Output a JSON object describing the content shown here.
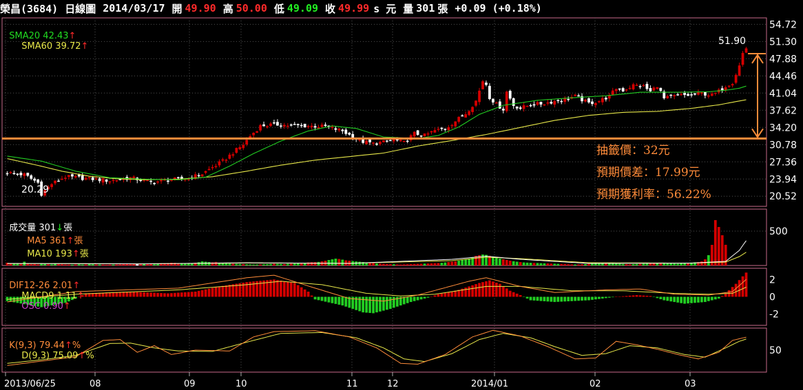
{
  "header": {
    "name": "榮昌(3684)",
    "period": "日線圖",
    "date": "2014/03/17",
    "open_label": "開",
    "open": "49.90",
    "high_label": "高",
    "high": "50.00",
    "low_label": "低",
    "low": "49.09",
    "close_label": "收",
    "close": "49.99",
    "unit": "s 元",
    "vol_label": "量",
    "volume": "301",
    "vol_unit": "張",
    "change": "+0.09 (+0.18%)"
  },
  "colors": {
    "up": "#d40000",
    "down": "#ffffff",
    "sma20": "#22cc22",
    "sma60": "#e8e84a",
    "frame": "#c86a8a",
    "grid": "#505050",
    "accent": "#ff8c3a",
    "osc": "#cc44cc"
  },
  "legends": {
    "price": {
      "sma20": "SMA20 42.43",
      "sma60": "SMA60 39.72",
      "arrow": "↑"
    },
    "volume": {
      "label": "成交量 301",
      "down_arrow": "↓",
      "unit": "張",
      "ma5": "MA5 361",
      "ma10": "MA10 193",
      "arrow": "↑"
    },
    "macd": {
      "dif": "DIF12-26 2.01",
      "macd": "MACD9 1.11",
      "osc": "OSC 0.90",
      "arrow": "↑"
    },
    "kd": {
      "k": "K(9,3) 79.44",
      "d": "D(9,3) 75.09",
      "arrow": "↑",
      "pct": "%"
    }
  },
  "annotations": {
    "lottery_price": "抽籤價：32元",
    "expected_spread": "預期價差：17.99元",
    "expected_return": "預期獲利率：56.22%",
    "high_label": "51.90",
    "low_label": "20.29"
  },
  "chart_data": [
    {
      "type": "candlestick",
      "title": "榮昌(3684) 日線圖",
      "ylim": [
        18.5,
        56
      ],
      "y_ticks": [
        "54.72",
        "51.30",
        "47.88",
        "44.46",
        "41.04",
        "37.62",
        "34.20",
        "30.78",
        "27.36",
        "23.94",
        "20.52"
      ],
      "x_ticks": [
        "2013/06/25",
        "08",
        "09",
        "10",
        "11",
        "12",
        "2014/01",
        "02",
        "03"
      ],
      "reference_line": 32,
      "recent_high": 51.9,
      "period_low": 20.29,
      "close_path": [
        [
          0,
          25.2
        ],
        [
          5,
          24.8
        ],
        [
          9,
          23.2
        ],
        [
          10,
          21.0
        ],
        [
          13,
          23.0
        ],
        [
          17,
          24.4
        ],
        [
          24,
          24.0
        ],
        [
          30,
          23.6
        ],
        [
          36,
          24.2
        ],
        [
          42,
          23.3
        ],
        [
          48,
          23.8
        ],
        [
          53,
          24.1
        ],
        [
          57,
          25.0
        ],
        [
          60,
          26.3
        ],
        [
          63,
          27.5
        ],
        [
          66,
          29.2
        ],
        [
          69,
          30.8
        ],
        [
          71,
          32.5
        ],
        [
          74,
          34.5
        ],
        [
          78,
          34.8
        ],
        [
          83,
          34.6
        ],
        [
          88,
          34.5
        ],
        [
          93,
          34.4
        ],
        [
          98,
          33.5
        ],
        [
          103,
          31.5
        ],
        [
          107,
          31.0
        ],
        [
          110,
          31.3
        ],
        [
          113,
          31.7
        ],
        [
          116,
          31.2
        ],
        [
          119,
          33.0
        ],
        [
          122,
          32.6
        ],
        [
          125,
          33.6
        ],
        [
          128,
          34.0
        ],
        [
          131,
          35.5
        ],
        [
          134,
          37.0
        ],
        [
          137,
          39.5
        ],
        [
          139,
          43.5
        ],
        [
          140,
          42.8
        ],
        [
          141,
          40.2
        ],
        [
          143,
          38.8
        ],
        [
          145,
          37.8
        ],
        [
          146,
          41.3
        ],
        [
          148,
          38.6
        ],
        [
          150,
          38.0
        ],
        [
          153,
          38.8
        ],
        [
          156,
          38.9
        ],
        [
          159,
          39.3
        ],
        [
          162,
          39.7
        ],
        [
          166,
          40.4
        ],
        [
          170,
          39.0
        ],
        [
          173,
          39.5
        ],
        [
          176,
          40.4
        ],
        [
          178,
          42.0
        ],
        [
          180,
          41.6
        ],
        [
          183,
          42.6
        ],
        [
          186,
          42.4
        ],
        [
          188,
          41.3
        ],
        [
          190,
          42.6
        ],
        [
          192,
          39.9
        ],
        [
          194,
          40.3
        ],
        [
          197,
          40.6
        ],
        [
          200,
          40.6
        ],
        [
          203,
          41.0
        ],
        [
          206,
          40.6
        ],
        [
          208,
          41.4
        ],
        [
          210,
          42.5
        ],
        [
          212,
          43.2
        ],
        [
          214,
          46.5
        ],
        [
          215,
          49.0
        ],
        [
          216,
          50.0
        ]
      ],
      "sma20_path": [
        [
          0,
          28.5
        ],
        [
          10,
          27.5
        ],
        [
          20,
          25.5
        ],
        [
          30,
          24.2
        ],
        [
          40,
          23.9
        ],
        [
          50,
          23.8
        ],
        [
          58,
          24.3
        ],
        [
          65,
          26.5
        ],
        [
          72,
          29.0
        ],
        [
          80,
          31.5
        ],
        [
          88,
          33.5
        ],
        [
          95,
          34.5
        ],
        [
          102,
          34.0
        ],
        [
          110,
          32.3
        ],
        [
          120,
          32.0
        ],
        [
          126,
          32.6
        ],
        [
          132,
          34.3
        ],
        [
          138,
          36.8
        ],
        [
          145,
          38.6
        ],
        [
          155,
          39.6
        ],
        [
          165,
          40.1
        ],
        [
          175,
          40.5
        ],
        [
          185,
          41.2
        ],
        [
          195,
          41.2
        ],
        [
          205,
          41.3
        ],
        [
          210,
          41.6
        ],
        [
          214,
          42.0
        ],
        [
          216,
          42.43
        ]
      ],
      "sma60_path": [
        [
          0,
          28.0
        ],
        [
          8,
          26.8
        ],
        [
          16,
          25.5
        ],
        [
          24,
          24.5
        ],
        [
          32,
          24.0
        ],
        [
          40,
          23.8
        ],
        [
          50,
          23.9
        ],
        [
          60,
          24.4
        ],
        [
          70,
          25.5
        ],
        [
          80,
          26.7
        ],
        [
          90,
          27.7
        ],
        [
          100,
          28.4
        ],
        [
          110,
          29.1
        ],
        [
          120,
          30.5
        ],
        [
          130,
          31.6
        ],
        [
          140,
          32.8
        ],
        [
          150,
          34.2
        ],
        [
          160,
          35.6
        ],
        [
          170,
          36.6
        ],
        [
          180,
          37.2
        ],
        [
          190,
          37.4
        ],
        [
          200,
          38.0
        ],
        [
          208,
          38.7
        ],
        [
          216,
          39.72
        ]
      ]
    },
    {
      "type": "bar",
      "title": "成交量",
      "ylim": [
        0,
        820
      ],
      "y_ticks": [
        500
      ],
      "values": [
        40,
        30,
        25,
        35,
        22,
        55,
        30,
        18,
        20,
        15,
        22,
        20,
        18,
        16,
        25,
        20,
        18,
        15,
        14,
        12,
        15,
        18,
        14,
        16,
        20,
        18,
        16,
        15,
        14,
        12,
        15,
        14,
        16,
        18,
        20,
        22,
        25,
        28,
        30,
        26,
        24,
        22,
        20,
        18,
        22,
        25,
        28,
        35,
        40,
        38,
        34,
        30,
        28,
        25,
        32,
        40,
        48,
        60,
        55,
        50,
        46,
        52,
        40,
        35,
        30,
        28,
        26,
        24,
        22,
        20,
        18,
        16,
        14,
        15,
        16,
        18,
        20,
        22,
        25,
        24,
        22,
        20,
        24,
        26,
        28,
        30,
        35,
        40,
        45,
        48,
        50,
        52,
        60,
        70,
        80,
        90,
        100,
        95,
        85,
        75,
        70,
        65,
        60,
        55,
        50,
        45,
        40,
        35,
        30,
        26,
        24,
        22,
        20,
        18,
        16,
        14,
        16,
        18,
        20,
        22,
        24,
        26,
        28,
        30,
        32,
        34,
        36,
        40,
        45,
        50,
        55,
        60,
        70,
        80,
        90,
        100,
        120,
        140,
        150,
        160,
        155,
        140,
        125,
        110,
        100,
        90,
        80,
        70,
        62,
        55,
        50,
        45,
        42,
        40,
        38,
        36,
        34,
        32,
        30,
        28,
        26,
        24,
        22,
        20,
        18,
        16,
        15,
        16,
        18,
        20,
        22,
        24,
        26,
        28,
        30,
        32,
        30,
        28,
        26,
        24,
        22,
        20,
        18,
        20,
        22,
        24,
        26,
        28,
        30,
        32,
        34,
        36,
        34,
        32,
        30,
        28,
        26,
        30,
        34,
        38,
        42,
        46,
        50,
        60,
        90,
        150,
        300,
        660,
        560,
        440,
        301
      ],
      "ma5_path": [
        [
          0,
          30
        ],
        [
          40,
          24
        ],
        [
          70,
          40
        ],
        [
          100,
          30
        ],
        [
          130,
          90
        ],
        [
          140,
          135
        ],
        [
          150,
          90
        ],
        [
          170,
          30
        ],
        [
          200,
          35
        ],
        [
          210,
          60
        ],
        [
          214,
          220
        ],
        [
          216,
          361
        ]
      ],
      "ma10_path": [
        [
          0,
          28
        ],
        [
          40,
          25
        ],
        [
          70,
          36
        ],
        [
          100,
          32
        ],
        [
          130,
          70
        ],
        [
          140,
          120
        ],
        [
          150,
          100
        ],
        [
          170,
          40
        ],
        [
          200,
          34
        ],
        [
          210,
          50
        ],
        [
          214,
          130
        ],
        [
          216,
          193
        ]
      ]
    },
    {
      "type": "bar",
      "title": "MACD",
      "ylim": [
        -3.3,
        3.3
      ],
      "y_ticks": [
        2,
        0,
        -2
      ],
      "osc_path": [
        [
          0,
          -0.5
        ],
        [
          10,
          -1.2
        ],
        [
          17,
          -0.7
        ],
        [
          20,
          -0.2
        ],
        [
          23,
          0.4
        ],
        [
          35,
          0.6
        ],
        [
          47,
          0.4
        ],
        [
          55,
          0.6
        ],
        [
          62,
          1.2
        ],
        [
          70,
          1.7
        ],
        [
          78,
          2.0
        ],
        [
          84,
          1.6
        ],
        [
          88,
          0.6
        ],
        [
          90,
          -0.3
        ],
        [
          98,
          -1.0
        ],
        [
          104,
          -1.8
        ],
        [
          107,
          -1.9
        ],
        [
          112,
          -1.4
        ],
        [
          118,
          -0.6
        ],
        [
          123,
          -0.1
        ],
        [
          126,
          0.3
        ],
        [
          132,
          0.8
        ],
        [
          138,
          1.6
        ],
        [
          141,
          1.9
        ],
        [
          144,
          1.5
        ],
        [
          147,
          0.7
        ],
        [
          150,
          0.2
        ],
        [
          153,
          -0.4
        ],
        [
          160,
          -0.6
        ],
        [
          170,
          -0.4
        ],
        [
          178,
          0.0
        ],
        [
          184,
          0.2
        ],
        [
          188,
          0.1
        ],
        [
          192,
          -0.4
        ],
        [
          198,
          -0.8
        ],
        [
          204,
          -0.6
        ],
        [
          208,
          -0.2
        ],
        [
          210,
          0.4
        ],
        [
          213,
          1.5
        ],
        [
          216,
          2.8
        ]
      ],
      "dif_path": [
        [
          0,
          -0.6
        ],
        [
          20,
          0.6
        ],
        [
          50,
          1.0
        ],
        [
          70,
          2.2
        ],
        [
          78,
          2.5
        ],
        [
          90,
          1.0
        ],
        [
          100,
          -0.2
        ],
        [
          110,
          -0.5
        ],
        [
          120,
          0.2
        ],
        [
          135,
          1.8
        ],
        [
          140,
          2.2
        ],
        [
          150,
          1.2
        ],
        [
          160,
          0.5
        ],
        [
          175,
          0.8
        ],
        [
          185,
          0.9
        ],
        [
          195,
          0.3
        ],
        [
          205,
          0.2
        ],
        [
          212,
          0.6
        ],
        [
          216,
          2.01
        ]
      ],
      "macd9_path": [
        [
          0,
          -0.3
        ],
        [
          20,
          0.3
        ],
        [
          50,
          0.8
        ],
        [
          70,
          1.4
        ],
        [
          80,
          1.8
        ],
        [
          92,
          1.4
        ],
        [
          105,
          0.4
        ],
        [
          115,
          0.1
        ],
        [
          125,
          0.3
        ],
        [
          140,
          1.2
        ],
        [
          150,
          1.2
        ],
        [
          165,
          0.7
        ],
        [
          180,
          0.7
        ],
        [
          195,
          0.4
        ],
        [
          205,
          0.3
        ],
        [
          212,
          0.4
        ],
        [
          216,
          1.11
        ]
      ]
    },
    {
      "type": "line",
      "title": "KD",
      "ylim": [
        0,
        100
      ],
      "y_ticks": [
        50
      ],
      "k_path": [
        [
          0,
          15
        ],
        [
          10,
          25
        ],
        [
          20,
          35
        ],
        [
          28,
          72
        ],
        [
          33,
          74
        ],
        [
          38,
          45
        ],
        [
          43,
          60
        ],
        [
          48,
          40
        ],
        [
          55,
          50
        ],
        [
          65,
          48
        ],
        [
          72,
          80
        ],
        [
          78,
          92
        ],
        [
          90,
          94
        ],
        [
          100,
          80
        ],
        [
          108,
          55
        ],
        [
          115,
          20
        ],
        [
          120,
          18
        ],
        [
          128,
          40
        ],
        [
          136,
          80
        ],
        [
          142,
          95
        ],
        [
          150,
          82
        ],
        [
          158,
          58
        ],
        [
          166,
          30
        ],
        [
          172,
          32
        ],
        [
          178,
          70
        ],
        [
          184,
          62
        ],
        [
          190,
          52
        ],
        [
          196,
          40
        ],
        [
          202,
          30
        ],
        [
          208,
          45
        ],
        [
          212,
          72
        ],
        [
          216,
          79.44
        ]
      ],
      "d_path": [
        [
          0,
          20
        ],
        [
          10,
          28
        ],
        [
          20,
          38
        ],
        [
          30,
          65
        ],
        [
          36,
          66
        ],
        [
          43,
          55
        ],
        [
          50,
          48
        ],
        [
          60,
          47
        ],
        [
          70,
          68
        ],
        [
          80,
          88
        ],
        [
          92,
          90
        ],
        [
          102,
          78
        ],
        [
          110,
          55
        ],
        [
          116,
          30
        ],
        [
          122,
          24
        ],
        [
          130,
          42
        ],
        [
          138,
          74
        ],
        [
          145,
          88
        ],
        [
          153,
          78
        ],
        [
          160,
          58
        ],
        [
          168,
          38
        ],
        [
          175,
          42
        ],
        [
          182,
          60
        ],
        [
          190,
          55
        ],
        [
          198,
          40
        ],
        [
          204,
          34
        ],
        [
          210,
          55
        ],
        [
          214,
          70
        ],
        [
          216,
          75.09
        ]
      ]
    }
  ]
}
